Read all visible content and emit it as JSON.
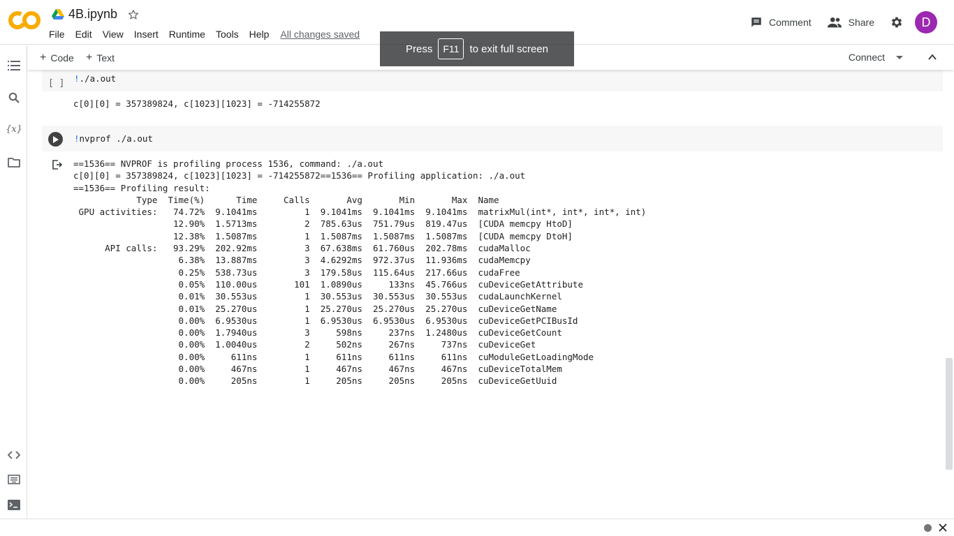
{
  "header": {
    "filename": "4B.ipynb",
    "menu": [
      "File",
      "Edit",
      "View",
      "Insert",
      "Runtime",
      "Tools",
      "Help"
    ],
    "saved_status": "All changes saved",
    "comment_label": "Comment",
    "share_label": "Share",
    "avatar_letter": "D"
  },
  "toolbar": {
    "code_label": "Code",
    "text_label": "Text",
    "connect_label": "Connect"
  },
  "toast": {
    "before": "Press",
    "key": "F11",
    "after": "to exit full screen"
  },
  "cells": {
    "cell1": {
      "bracket": "[ ]",
      "bang": "!",
      "code": "./a.out",
      "output": "c[0][0] = 357389824, c[1023][1023] = -714255872"
    },
    "cell2": {
      "bang": "!",
      "code": "nvprof ./a.out",
      "output_lines": [
        "==1536== NVPROF is profiling process 1536, command: ./a.out",
        "c[0][0] = 357389824, c[1023][1023] = -714255872==1536== Profiling application: ./a.out",
        "==1536== Profiling result:",
        "            Type  Time(%)      Time     Calls       Avg       Min       Max  Name",
        " GPU activities:   74.72%  9.1041ms         1  9.1041ms  9.1041ms  9.1041ms  matrixMul(int*, int*, int*, int)",
        "                   12.90%  1.5713ms         2  785.63us  751.79us  819.47us  [CUDA memcpy HtoD]",
        "                   12.38%  1.5087ms         1  1.5087ms  1.5087ms  1.5087ms  [CUDA memcpy DtoH]",
        "      API calls:   93.29%  202.92ms         3  67.638ms  61.760us  202.78ms  cudaMalloc",
        "                    6.38%  13.887ms         3  4.6292ms  972.37us  11.936ms  cudaMemcpy",
        "                    0.25%  538.73us         3  179.58us  115.64us  217.66us  cudaFree",
        "                    0.05%  110.00us       101  1.0890us     133ns  45.766us  cuDeviceGetAttribute",
        "                    0.01%  30.553us         1  30.553us  30.553us  30.553us  cudaLaunchKernel",
        "                    0.01%  25.270us         1  25.270us  25.270us  25.270us  cuDeviceGetName",
        "                    0.00%  6.9530us         1  6.9530us  6.9530us  6.9530us  cuDeviceGetPCIBusId",
        "                    0.00%  1.7940us         3     598ns     237ns  1.2480us  cuDeviceGetCount",
        "                    0.00%  1.0040us         2     502ns     267ns     737ns  cuDeviceGet",
        "                    0.00%     611ns         1     611ns     611ns     611ns  cuModuleGetLoadingMode",
        "                    0.00%     467ns         1     467ns     467ns     467ns  cuDeviceTotalMem",
        "                    0.00%     205ns         1     205ns     205ns     205ns  cuDeviceGetUuid"
      ]
    }
  },
  "colors": {
    "logo_orange": "#f9ab00",
    "avatar": "#9c27b0",
    "accent": "#1a73e8"
  }
}
